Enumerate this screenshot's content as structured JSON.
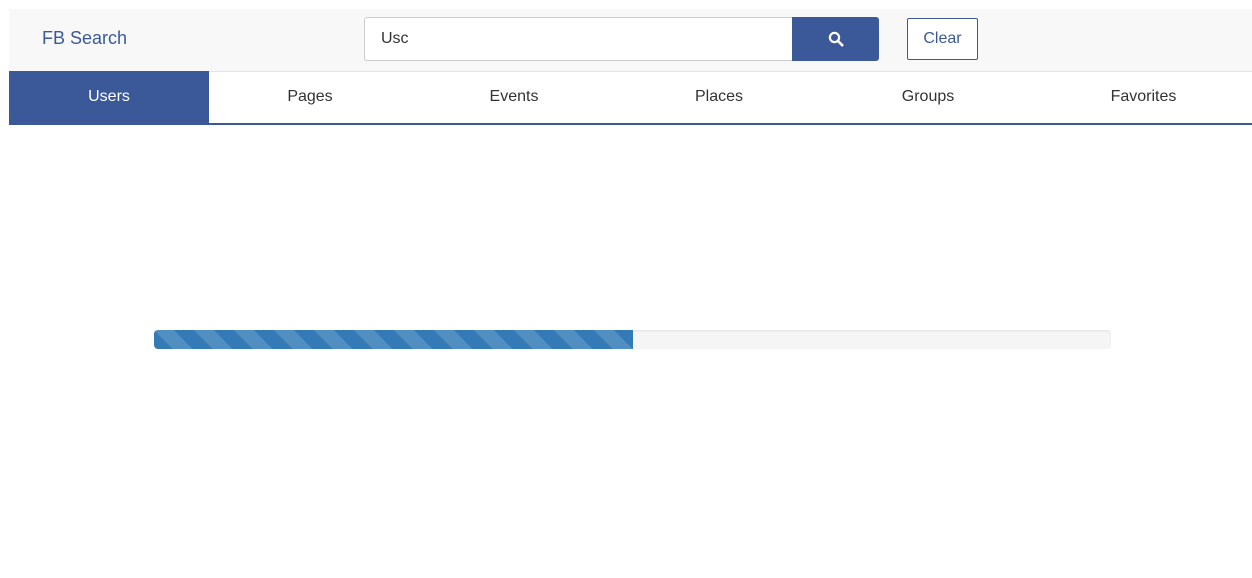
{
  "app": {
    "brand": "FB Search"
  },
  "search": {
    "value": "Usc",
    "button_icon": "search-icon",
    "clear_label": "Clear"
  },
  "tabs": [
    {
      "label": "Users",
      "active": true
    },
    {
      "label": "Pages",
      "active": false
    },
    {
      "label": "Events",
      "active": false
    },
    {
      "label": "Places",
      "active": false
    },
    {
      "label": "Groups",
      "active": false
    },
    {
      "label": "Favorites",
      "active": false
    }
  ],
  "progress": {
    "value_percent": 50,
    "striped": true
  },
  "colors": {
    "brand": "#3b5998",
    "progress": "#337ab7",
    "navbar_bg": "#f8f8f8"
  }
}
